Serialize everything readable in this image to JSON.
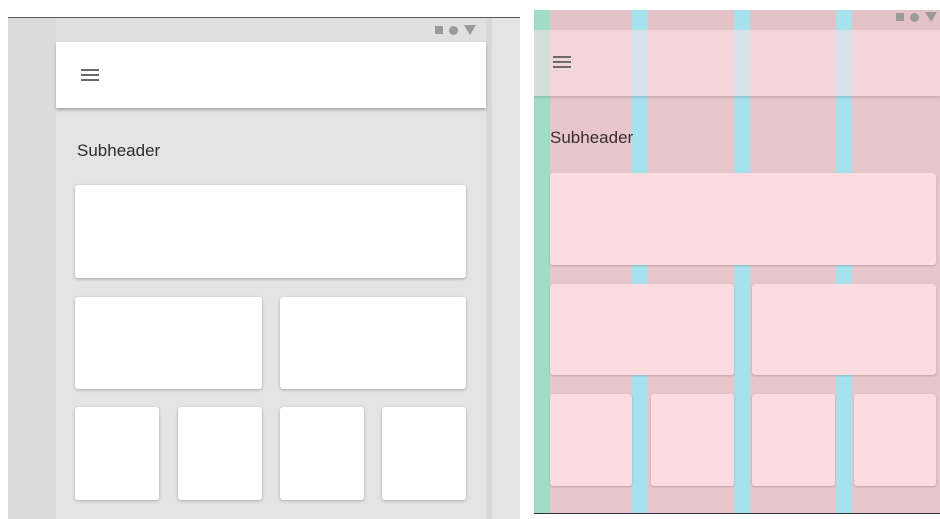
{
  "left": {
    "subheader": "Subheader",
    "status_icons": [
      "square-icon",
      "circle-icon",
      "triangle-icon"
    ],
    "menu_icon": "menu-icon"
  },
  "right": {
    "subheader": "Subheader",
    "status_icons": [
      "square-icon",
      "circle-icon",
      "triangle-icon"
    ],
    "menu_icon": "menu-icon"
  },
  "colors": {
    "surface": "#e4e4e4",
    "card": "#ffffff",
    "column_overlay": "#e6c6cb",
    "gutter_overlay": "#a6e1ee",
    "margin_overlay": "#a0dcc6",
    "card_overlay": "#fddbe1"
  }
}
